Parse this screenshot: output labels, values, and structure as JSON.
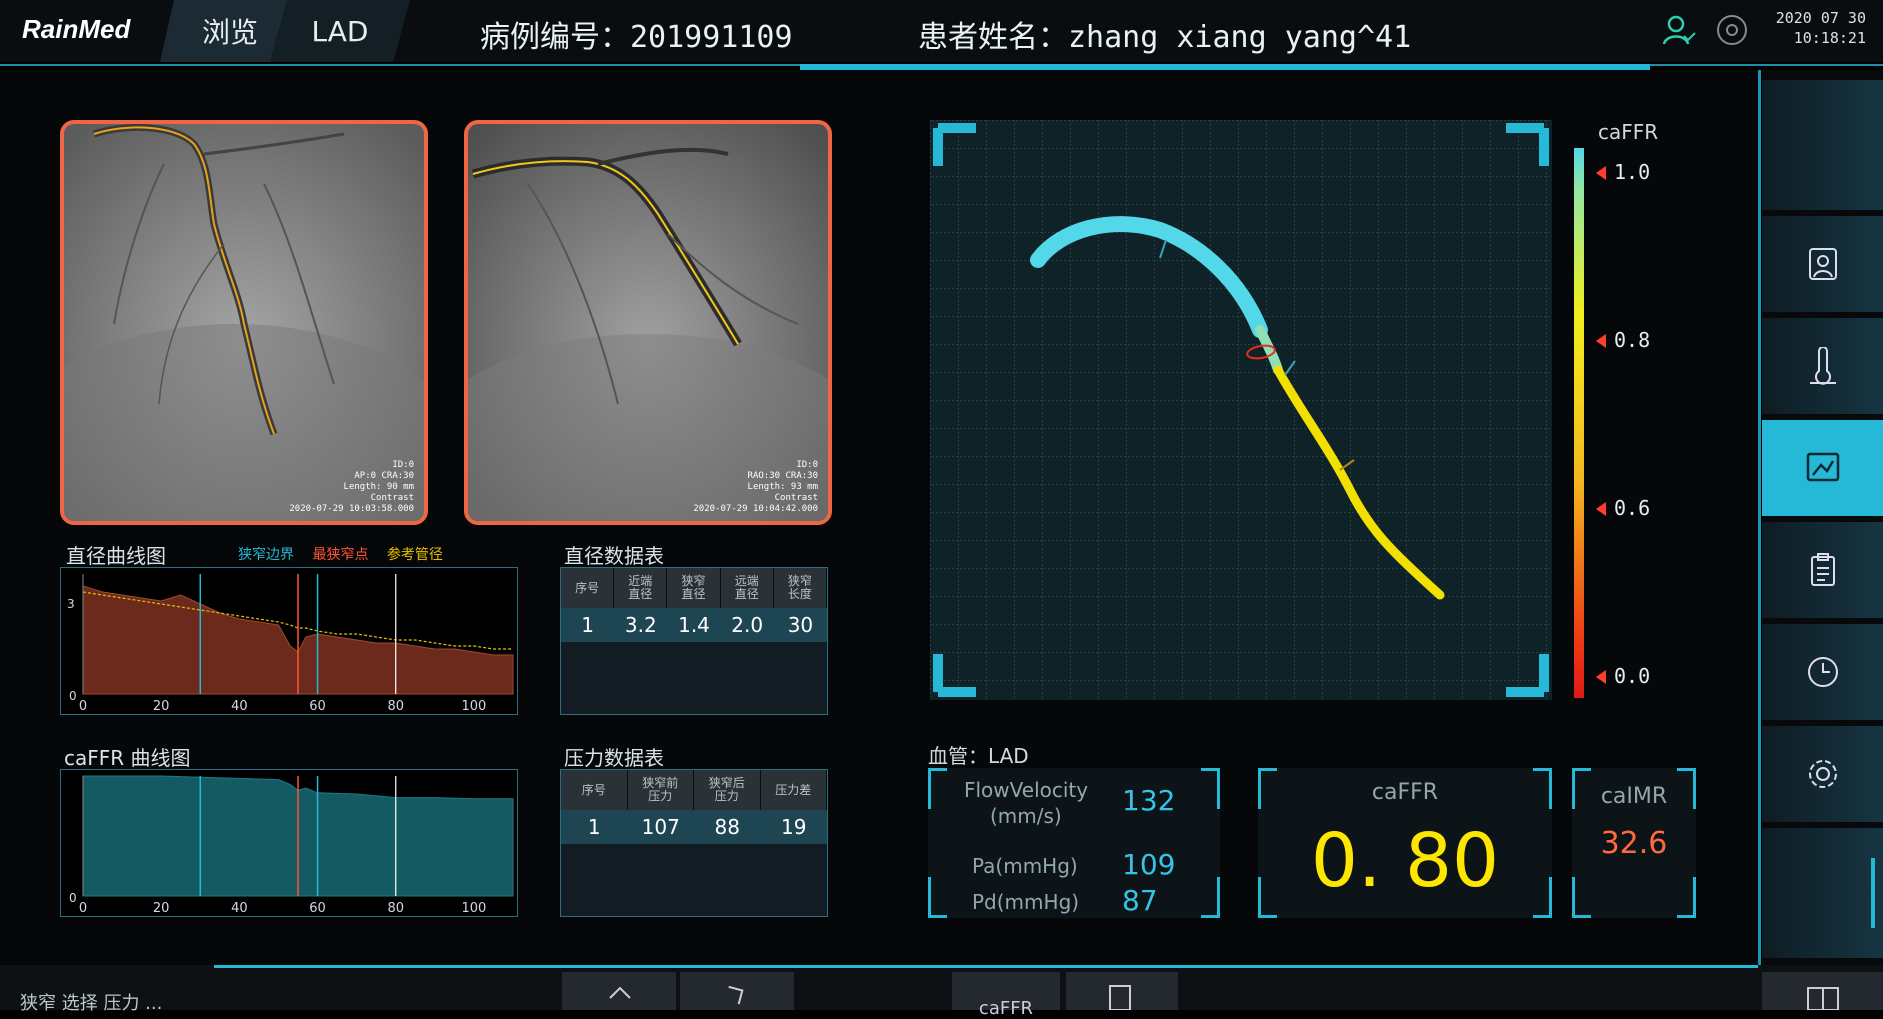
{
  "header": {
    "logo": "RainMed",
    "tab_browse": "浏览",
    "tab_vessel": "LAD",
    "case_label": "病例编号：",
    "case_id": "201991109",
    "patient_label": "患者姓名：",
    "patient_name": "zhang xiang yang^41",
    "date": "2020 07 30",
    "time": "10:18:21"
  },
  "angio": [
    {
      "line1": "ID:0",
      "line2": "AP:0 CRA:30",
      "line3": "Length: 90 mm",
      "line4": "Contrast",
      "line5": "2020-07-29 10:03:58.000"
    },
    {
      "line1": "ID:0",
      "line2": "RAO:30 CRA:30",
      "line3": "Length: 93 mm",
      "line4": "Contrast",
      "line5": "2020-07-29 10:04:42.000"
    }
  ],
  "diameter_chart": {
    "title": "直径曲线图",
    "legend": [
      "狭窄边界",
      "最狭窄点",
      "参考管径"
    ],
    "legend_colors": [
      "#25b9d7",
      "#ff5533",
      "#e8c000"
    ],
    "y_tick": "3",
    "x_ticks": [
      "0",
      "20",
      "40",
      "60",
      "80",
      "100"
    ],
    "y_zero": "0"
  },
  "caffr_chart": {
    "title": "caFFR 曲线图",
    "x_ticks": [
      "0",
      "20",
      "40",
      "60",
      "80",
      "100"
    ],
    "y_zero": "0"
  },
  "chart_data": [
    {
      "type": "area",
      "title": "直径曲线图",
      "x": [
        0,
        5,
        10,
        15,
        20,
        25,
        30,
        35,
        40,
        45,
        50,
        53,
        55,
        57,
        60,
        65,
        70,
        75,
        80,
        85,
        90,
        95,
        100,
        105,
        110
      ],
      "series": [
        {
          "name": "直径",
          "values": [
            3.6,
            3.4,
            3.3,
            3.2,
            3.1,
            3.3,
            3.0,
            2.7,
            2.5,
            2.4,
            2.3,
            1.6,
            1.4,
            1.9,
            2.0,
            1.9,
            1.8,
            1.7,
            1.7,
            1.6,
            1.5,
            1.5,
            1.4,
            1.3,
            1.3
          ]
        },
        {
          "name": "参考管径",
          "values": [
            3.4,
            3.3,
            3.2,
            3.1,
            3.0,
            2.9,
            2.8,
            2.7,
            2.6,
            2.5,
            2.4,
            2.3,
            2.2,
            2.2,
            2.1,
            2.0,
            2.0,
            1.9,
            1.8,
            1.8,
            1.7,
            1.6,
            1.6,
            1.5,
            1.5
          ]
        }
      ],
      "markers": {
        "狭窄边界": [
          30,
          60
        ],
        "最狭窄点": 55,
        "white_line": 80
      },
      "xlim": [
        0,
        110
      ],
      "ylim": [
        0,
        4
      ]
    },
    {
      "type": "area",
      "title": "caFFR 曲线图",
      "x": [
        0,
        10,
        20,
        30,
        40,
        50,
        53,
        55,
        57,
        60,
        70,
        80,
        90,
        100,
        110
      ],
      "series": [
        {
          "name": "caFFR",
          "values": [
            1.0,
            1.0,
            1.0,
            0.99,
            0.98,
            0.97,
            0.93,
            0.88,
            0.9,
            0.86,
            0.85,
            0.82,
            0.82,
            0.81,
            0.81
          ]
        }
      ],
      "markers": {
        "狭窄边界": [
          30,
          60
        ],
        "最狭窄点": 55,
        "white_line": 80
      },
      "xlim": [
        0,
        110
      ],
      "ylim": [
        0,
        1.0
      ]
    }
  ],
  "diameter_table": {
    "title": "直径数据表",
    "headers": [
      "序号",
      "近端\n直径",
      "狭窄\n直径",
      "远端\n直径",
      "狭窄\n长度"
    ],
    "row": [
      "1",
      "3.2",
      "1.4",
      "2.0",
      "30"
    ]
  },
  "pressure_table": {
    "title": "压力数据表",
    "headers": [
      "序号",
      "狭窄前\n压力",
      "狭窄后\n压力",
      "压力差"
    ],
    "row": [
      "1",
      "107",
      "88",
      "19"
    ]
  },
  "scale": {
    "title": "caFFR",
    "ticks": [
      "1.0",
      "0.8",
      "0.6",
      "0.0"
    ]
  },
  "vessel": {
    "label": "血管：",
    "name": "LAD"
  },
  "metrics": {
    "flow_label": "FlowVelocity",
    "flow_unit": "(mm/s)",
    "flow_value": "132",
    "pa_label": "Pa(mmHg)",
    "pa_value": "109",
    "pd_label": "Pd(mmHg)",
    "pd_value": "87",
    "caffr_label": "caFFR",
    "caffr_value": "0. 80",
    "caimr_label": "caIMR",
    "caimr_value": "32.6"
  },
  "icons": [
    "user-icon",
    "disc-icon",
    "patient-card-icon",
    "thermometer-icon",
    "report-image-icon",
    "clipboard-icon",
    "clock-icon",
    "settings-icon",
    "back-arrow-icon",
    "forward-arrow-icon",
    "export-icon",
    "layout-icon"
  ],
  "colors": {
    "accent": "#25b9d7",
    "active": "#25b9d7",
    "caffr_value": "#ffe600",
    "caimr_value": "#ff6a3a",
    "thumb_border": "#ee6644"
  },
  "bottom": {
    "text": "狭窄 选择 压力 ...",
    "caffr_btn": "caFFR"
  }
}
